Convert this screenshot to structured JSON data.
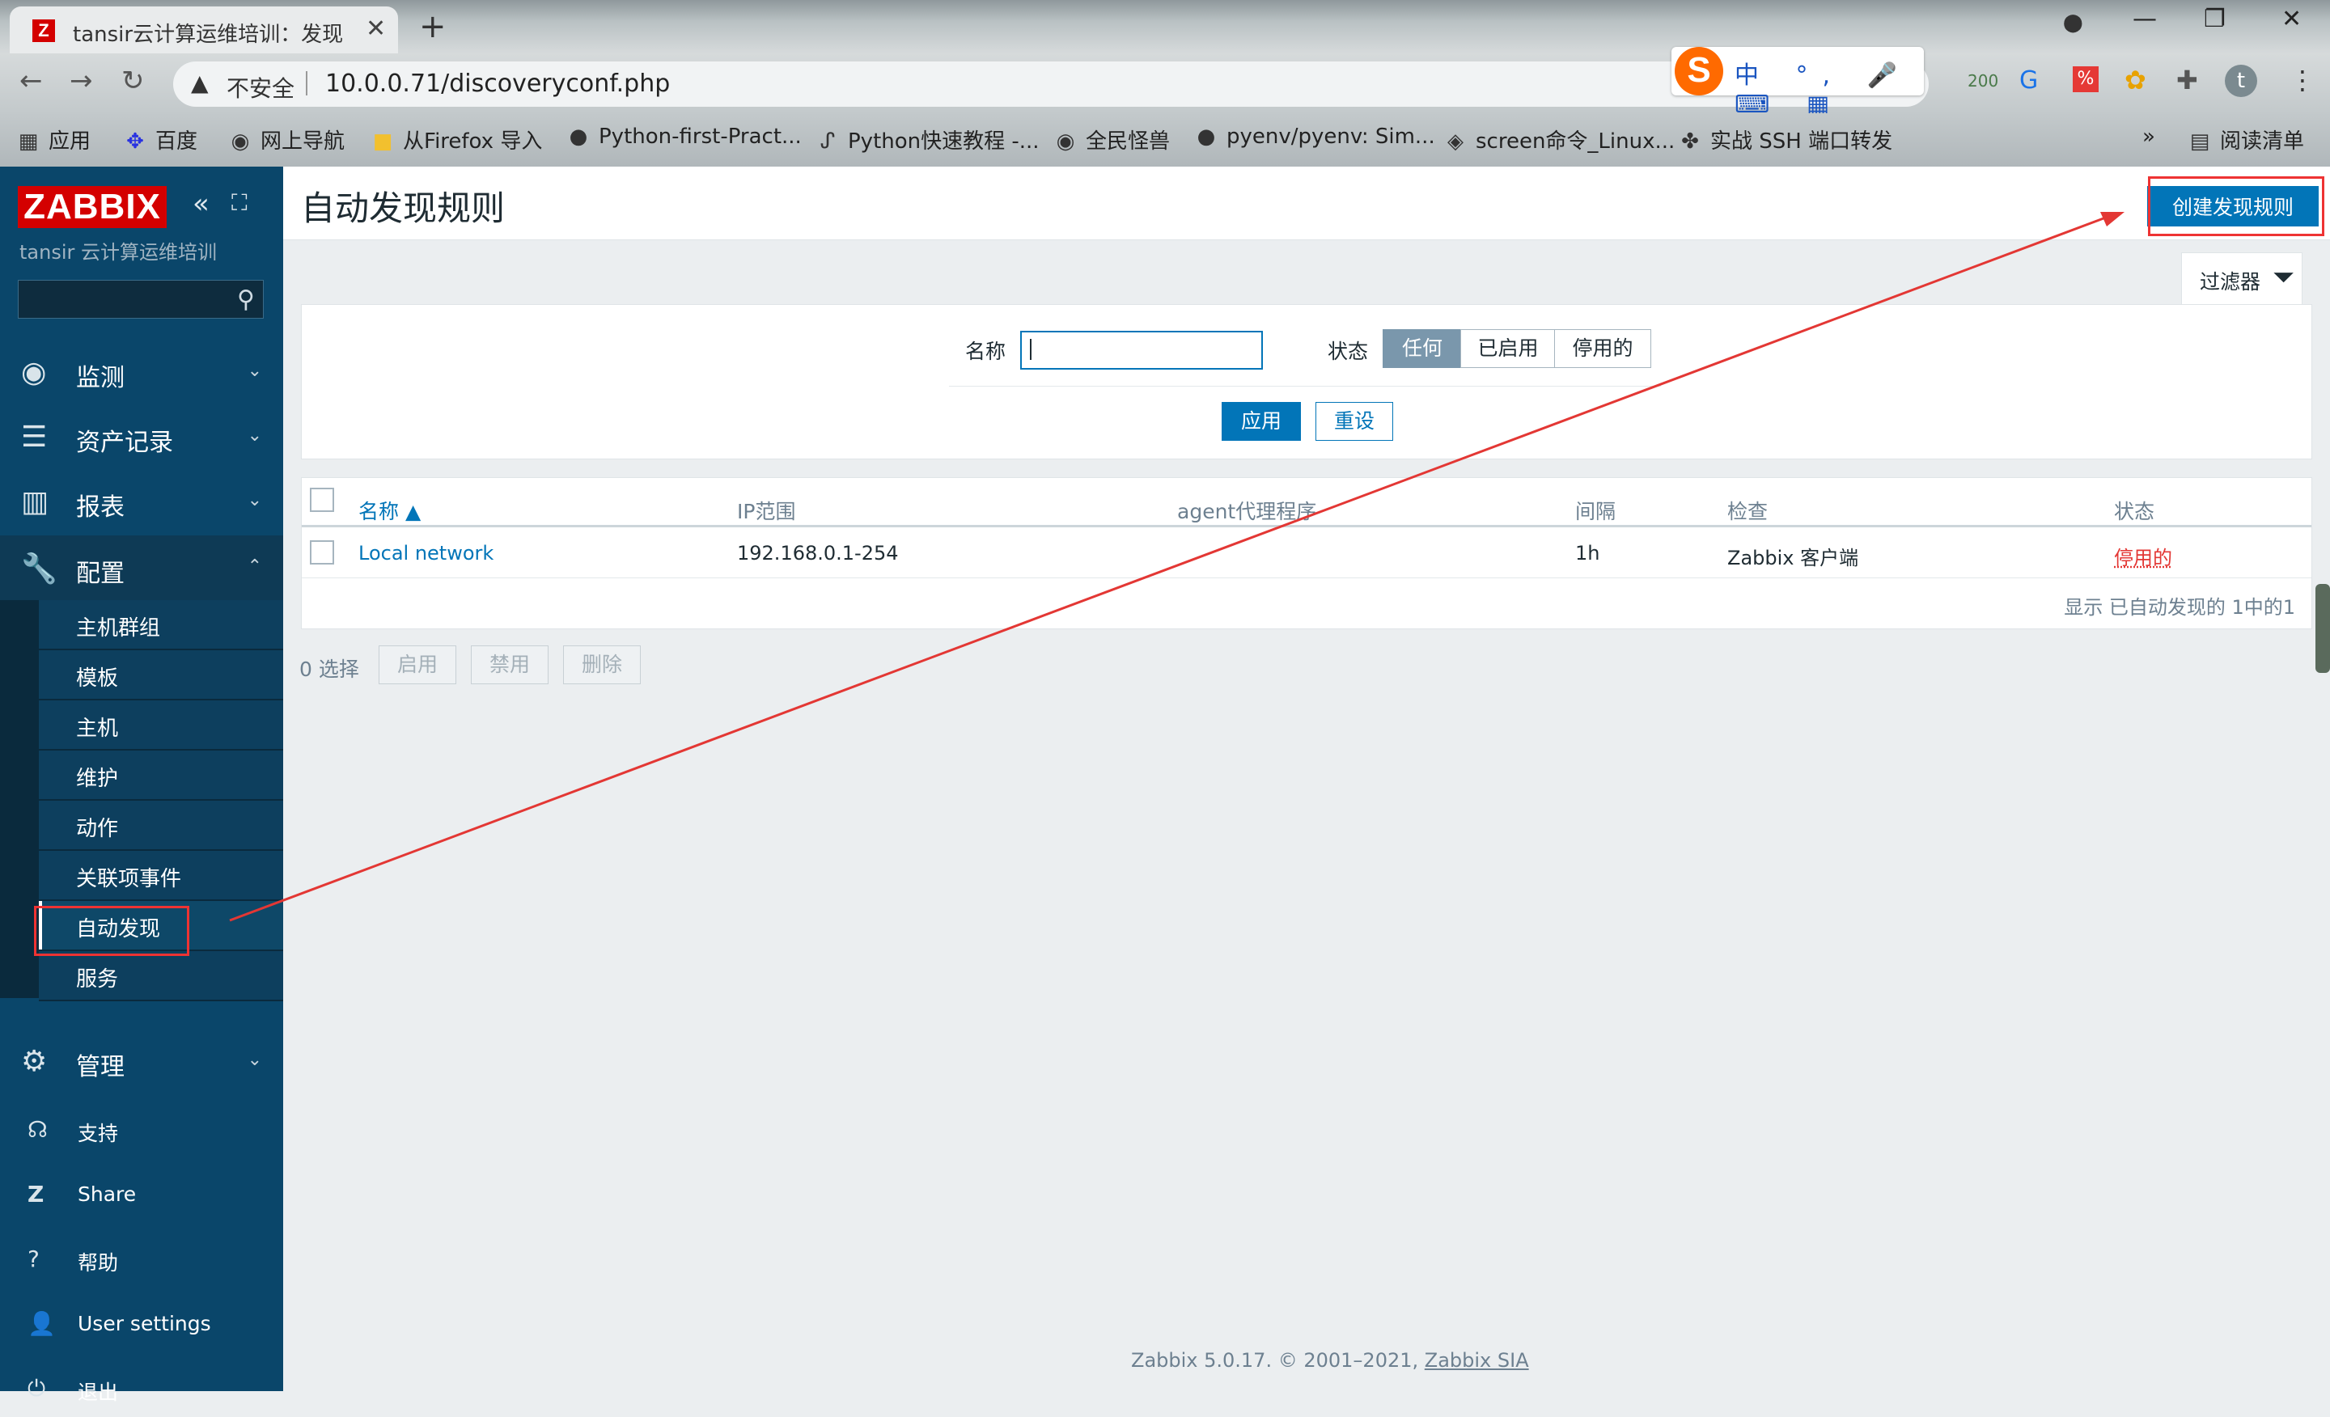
{
  "browser": {
    "tab_title": "tansir云计算运维培训：发现",
    "new_tab": "+",
    "close_tab": "✕",
    "win_min": "—",
    "win_max": "❐",
    "win_close": "✕",
    "security": "不安全",
    "url": "10.0.0.71/discoveryconf.php",
    "ime_text": "中 °, 🎤 ⌨ ▦",
    "ext_badge": "200",
    "profile_initial": "t",
    "bookmarks": [
      {
        "icon": "apps-icon",
        "label": "应用"
      },
      {
        "icon": "baidu-icon",
        "label": "百度"
      },
      {
        "icon": "globe-icon",
        "label": "网上导航"
      },
      {
        "icon": "folder-icon",
        "label": "从Firefox 导入"
      },
      {
        "icon": "github-icon",
        "label": "Python-first-Pract..."
      },
      {
        "icon": "python-icon",
        "label": "Python快速教程 -..."
      },
      {
        "icon": "globe-icon",
        "label": "全民怪兽"
      },
      {
        "icon": "github-icon",
        "label": "pyenv/pyenv: Sim..."
      },
      {
        "icon": "linux-icon",
        "label": "screen命令_Linux..."
      },
      {
        "icon": "ssh-icon",
        "label": "实战 SSH 端口转发"
      }
    ],
    "more_bookmarks": "»",
    "reading_list": "阅读清单"
  },
  "sidebar": {
    "logo": "ZABBIX",
    "org": "tansir 云计算运维培训",
    "search_placeholder": "",
    "menu": [
      {
        "icon": "eye-icon",
        "label": "监测"
      },
      {
        "icon": "list-icon",
        "label": "资产记录"
      },
      {
        "icon": "chart-icon",
        "label": "报表"
      },
      {
        "icon": "wrench-icon",
        "label": "配置"
      }
    ],
    "config_submenu": [
      "主机群组",
      "模板",
      "主机",
      "维护",
      "动作",
      "关联项事件",
      "自动发现",
      "服务"
    ],
    "admin": {
      "icon": "gear-icon",
      "label": "管理"
    },
    "bottom": [
      {
        "icon": "support-icon",
        "label": "支持"
      },
      {
        "icon": "share-icon",
        "label": "Share"
      },
      {
        "icon": "help-icon",
        "label": "帮助"
      },
      {
        "icon": "user-icon",
        "label": "User settings"
      },
      {
        "icon": "power-icon",
        "label": "退出"
      }
    ]
  },
  "page": {
    "title": "自动发现规则",
    "create_button": "创建发现规则",
    "filter_tab": "过滤器",
    "filter": {
      "name_label": "名称",
      "name_value": "",
      "state_label": "状态",
      "state_options": [
        "任何",
        "已启用",
        "停用的"
      ],
      "state_selected": "任何",
      "apply": "应用",
      "reset": "重设"
    },
    "table": {
      "headers": [
        "名称 ▲",
        "IP范围",
        "agent代理程序",
        "间隔",
        "检查",
        "状态"
      ],
      "rows": [
        {
          "name": "Local network",
          "ip_range": "192.168.0.1-254",
          "proxy": "",
          "interval": "1h",
          "checks": "Zabbix 客户端",
          "status": "停用的"
        }
      ],
      "summary": "显示 已自动发现的 1中的1"
    },
    "mass": {
      "selected": "0 选择",
      "enable": "启用",
      "disable": "禁用",
      "delete": "删除"
    },
    "footer": {
      "text": "Zabbix 5.0.17. © 2001–2021,",
      "link": "Zabbix SIA"
    }
  },
  "colors": {
    "accent": "#0275b8",
    "sidebar": "#0a466a",
    "annotation": "#e33734"
  }
}
